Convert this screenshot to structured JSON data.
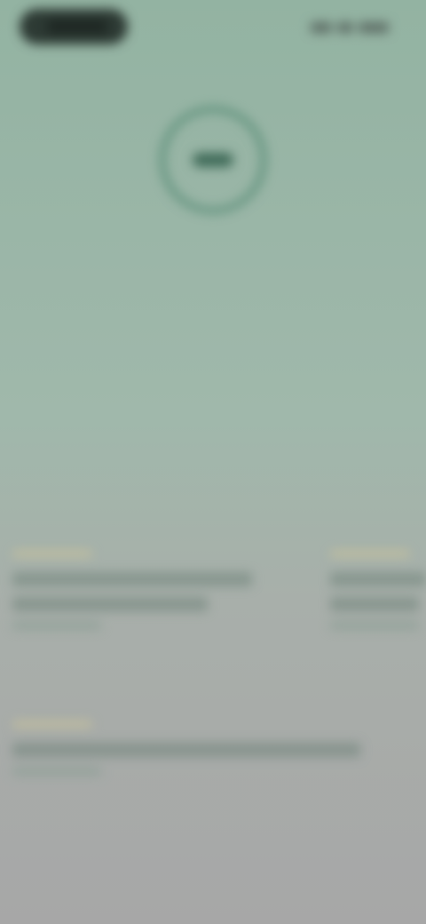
{
  "status_bar": {
    "icons": [
      "signal-icon",
      "wifi-icon",
      "battery-icon"
    ]
  },
  "hero": {
    "badge_icon": "circle-badge-icon",
    "eyebrow": "",
    "title": "",
    "subtitle": ""
  },
  "cards": [
    {
      "label": "",
      "lines": 2,
      "meta": ""
    },
    {
      "label": "",
      "lines": 2,
      "meta": ""
    },
    {
      "label": "",
      "lines": 1,
      "meta": ""
    }
  ],
  "colors": {
    "accent": "#2e5c4a",
    "badge_ring": "#5a8e78",
    "highlight": "#c8c29c"
  }
}
